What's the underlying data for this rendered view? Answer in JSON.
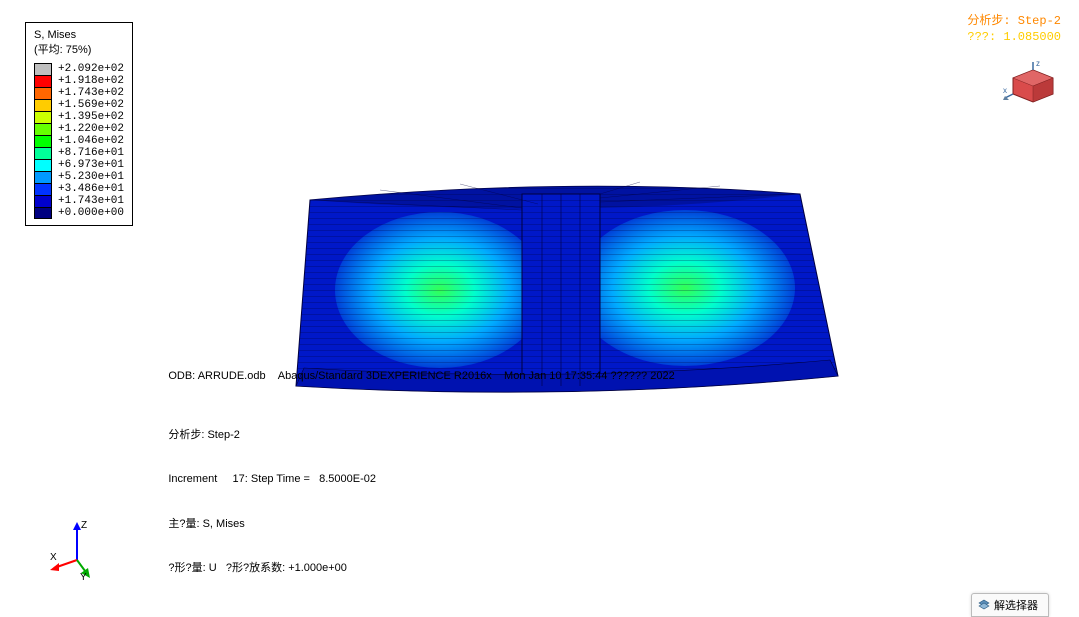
{
  "legend": {
    "title_line1": "S, Mises",
    "title_line2": "(平均: 75%)",
    "items": [
      {
        "color": "#bfbfbf",
        "value": "+2.092e+02"
      },
      {
        "color": "#ff0000",
        "value": "+1.918e+02"
      },
      {
        "color": "#ff6600",
        "value": "+1.743e+02"
      },
      {
        "color": "#ffcc00",
        "value": "+1.569e+02"
      },
      {
        "color": "#ccff00",
        "value": "+1.395e+02"
      },
      {
        "color": "#66ff00",
        "value": "+1.220e+02"
      },
      {
        "color": "#00ff00",
        "value": "+1.046e+02"
      },
      {
        "color": "#00ff99",
        "value": "+8.716e+01"
      },
      {
        "color": "#00ffff",
        "value": "+6.973e+01"
      },
      {
        "color": "#0099ff",
        "value": "+5.230e+01"
      },
      {
        "color": "#0033ff",
        "value": "+3.486e+01"
      },
      {
        "color": "#0000cc",
        "value": "+1.743e+01"
      },
      {
        "color": "#000080",
        "value": "+0.000e+00"
      }
    ]
  },
  "status": {
    "line1_label": "分析步:",
    "line1_value": "Step-2",
    "line2_label": "???:",
    "line2_value": "1.085000"
  },
  "info": {
    "odb_label": "ODB:",
    "odb_file": "ARRUDE.odb",
    "solver": "Abaqus/Standard 3DEXPERIENCE R2016x",
    "datetime": "Mon Jan 10 17:35:44 ?????? 2022",
    "step_label": "分析步:",
    "step_value": "Step-2",
    "increment_label": "Increment",
    "increment_num": "17",
    "steptime_label": "Step Time =",
    "steptime_value": "8.5000E-02",
    "primary_label": "主?量:",
    "primary_value": "S, Mises",
    "deform_label": "?形?量:",
    "deform_value": "U",
    "scale_label": "?形?放系数:",
    "scale_value": "+1.000e+00"
  },
  "axes": {
    "x": "X",
    "y": "Y",
    "z": "Z"
  },
  "popup": {
    "label": "解选择器"
  }
}
